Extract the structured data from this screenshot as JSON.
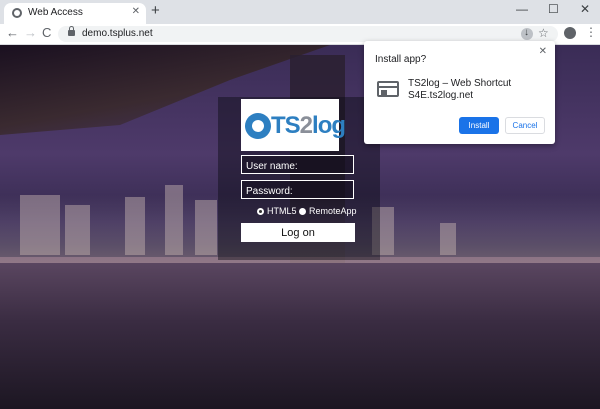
{
  "browser": {
    "tab_title": "Web Access",
    "tab_close": "✕",
    "new_tab": "+",
    "window_controls": {
      "minimize": "—",
      "maximize": "☐",
      "close": "✕"
    },
    "nav": {
      "back": "←",
      "forward": "→",
      "reload": "C"
    },
    "url": "demo.tsplus.net",
    "star": "☆",
    "menu": "⋮"
  },
  "login": {
    "logo": {
      "ts": "TS",
      "two": "2",
      "log": "log"
    },
    "username_placeholder": "User name:",
    "password_placeholder": "Password:",
    "mode_options": [
      {
        "label": "HTML5",
        "selected": true
      },
      {
        "label": "RemoteApp",
        "selected": false
      }
    ],
    "logon_label": "Log on"
  },
  "install_popup": {
    "title": "Install app?",
    "close": "✕",
    "app_name": "TS2log – Web Shortcut",
    "app_url": "S4E.ts2log.net",
    "install_label": "Install",
    "cancel_label": "Cancel"
  },
  "colors": {
    "accent": "#1a73e8",
    "brand": "#2d7fc1"
  }
}
